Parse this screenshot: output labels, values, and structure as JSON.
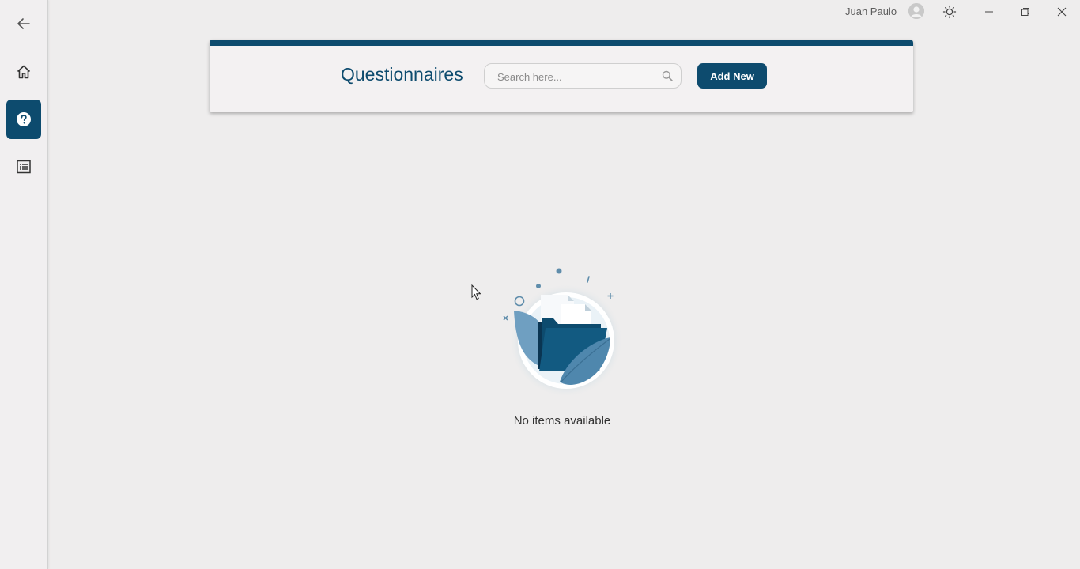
{
  "user": {
    "name": "Juan Paulo"
  },
  "header": {
    "title": "Questionnaires",
    "search_placeholder": "Search here...",
    "add_button_label": "Add New"
  },
  "empty_state": {
    "message": "No items available"
  },
  "sidebar": {
    "items": [
      {
        "icon": "back-arrow-icon",
        "active": false
      },
      {
        "icon": "home-icon",
        "active": false
      },
      {
        "icon": "question-circle-icon",
        "active": true
      },
      {
        "icon": "list-icon",
        "active": false
      }
    ]
  },
  "colors": {
    "accent": "#0d4b6e",
    "background": "#eeeded"
  }
}
